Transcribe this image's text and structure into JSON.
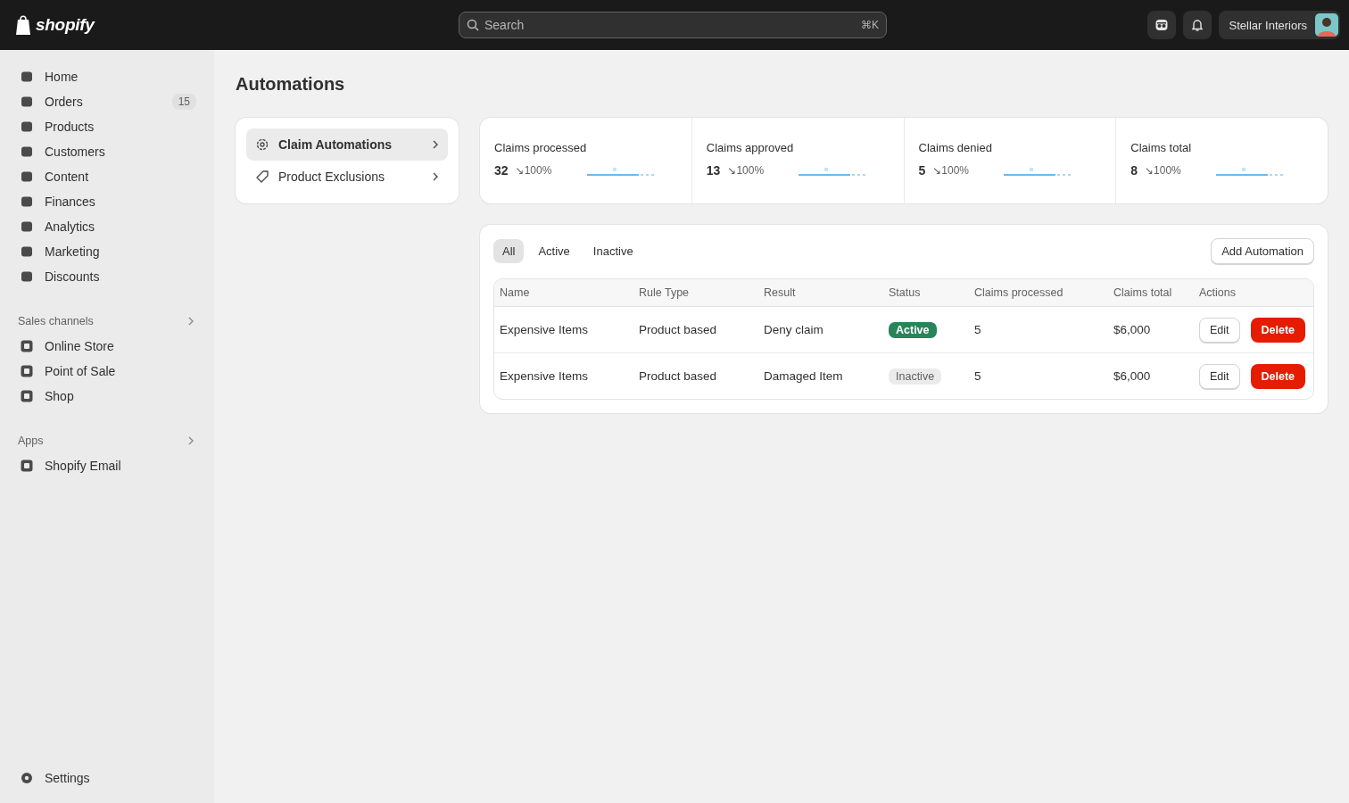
{
  "topbar": {
    "logo": "shopify",
    "search": {
      "placeholder": "Search",
      "shortcut": "⌘K"
    },
    "store": "Stellar Interiors"
  },
  "sidebar": {
    "items": [
      {
        "label": "Home",
        "selected": false
      },
      {
        "label": "Orders",
        "selected": false,
        "badge": "15"
      },
      {
        "label": "Products",
        "selected": false
      },
      {
        "label": "Customers",
        "selected": false
      },
      {
        "label": "Content",
        "selected": false
      },
      {
        "label": "Finances",
        "selected": false
      },
      {
        "label": "Analytics",
        "selected": false
      },
      {
        "label": "Marketing",
        "selected": false
      },
      {
        "label": "Discounts",
        "selected": false
      }
    ],
    "sections": [
      {
        "title": "Sales channels",
        "items": [
          {
            "label": "Online Store",
            "selected": false
          },
          {
            "label": "Point of Sale",
            "selected": false
          },
          {
            "label": "Shop",
            "selected": false
          }
        ]
      },
      {
        "title": "Apps",
        "items": [
          {
            "label": "Shopify Email",
            "selected": false
          }
        ]
      }
    ],
    "settings": "Settings"
  },
  "page_title": "Automations",
  "menu": [
    {
      "label": "Claim Automations",
      "selected": true
    },
    {
      "label": "Product Exclusions",
      "selected": false
    }
  ],
  "stats": [
    {
      "label": "Claims processed",
      "value": "32",
      "change": "↘100%"
    },
    {
      "label": "Claims approved",
      "value": "13",
      "change": "↘100%"
    },
    {
      "label": "Claims denied",
      "value": "5",
      "change": "↘100%"
    },
    {
      "label": "Claims total",
      "value": "8",
      "change": "↘100%"
    }
  ],
  "filters": [
    {
      "label": "All",
      "selected": true
    },
    {
      "label": "Active",
      "selected": false
    },
    {
      "label": "Inactive",
      "selected": false
    }
  ],
  "add_button": "Add Automation",
  "table": {
    "columns": [
      "Name",
      "Rule Type",
      "Result",
      "Status",
      "Claims processed",
      "Claims total",
      "Actions"
    ],
    "rows": [
      {
        "name": "Expensive Items",
        "rule_type": "Product based",
        "result": "Deny claim",
        "status": {
          "label": "Active",
          "active": true
        },
        "processed": "5",
        "total": "$6,000",
        "actions": [
          "Edit",
          "Delete"
        ]
      },
      {
        "name": "Expensive Items",
        "rule_type": "Product based",
        "result": "Damaged Item",
        "status": {
          "label": "Inactive",
          "active": false
        },
        "processed": "5",
        "total": "$6,000",
        "actions": [
          "Edit",
          "Delete"
        ]
      }
    ]
  }
}
